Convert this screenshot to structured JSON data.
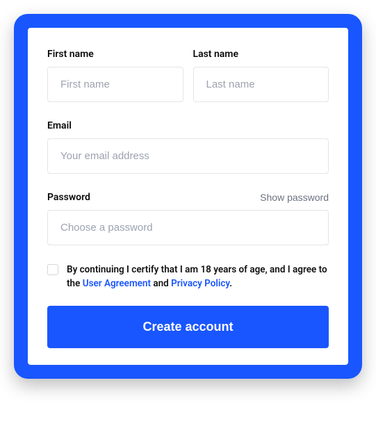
{
  "firstName": {
    "label": "First name",
    "placeholder": "First name",
    "value": ""
  },
  "lastName": {
    "label": "Last name",
    "placeholder": "Last name",
    "value": ""
  },
  "email": {
    "label": "Email",
    "placeholder": "Your email address",
    "value": ""
  },
  "password": {
    "label": "Password",
    "placeholder": "Choose a password",
    "showLabel": "Show password",
    "value": ""
  },
  "consent": {
    "pre": "By continuing I certify that I am 18 years of age, and I agree to the ",
    "userAgreement": "User Agreement",
    "middle": " and ",
    "privacyPolicy": "Privacy Policy",
    "suffix": "."
  },
  "submit": "Create account"
}
